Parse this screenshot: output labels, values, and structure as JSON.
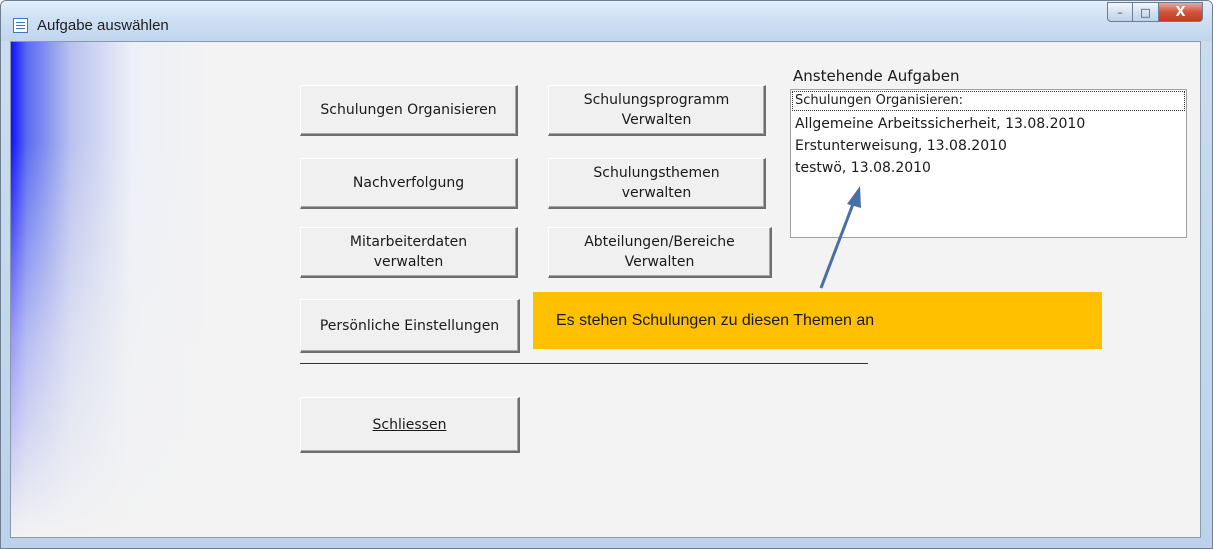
{
  "window": {
    "title": "Aufgabe auswählen",
    "controls": {
      "minimize": "–",
      "maximize": "□",
      "close": "X"
    }
  },
  "buttons": {
    "schulungen_organisieren": "Schulungen Organisieren",
    "schulungsprogramm_verwalten": [
      "Schulungsprogramm",
      "Verwalten"
    ],
    "nachverfolgung": "Nachverfolgung",
    "schulungsthemen_verwalten": [
      "Schulungsthemen",
      "verwalten"
    ],
    "mitarbeiterdaten_verwalten": [
      "Mitarbeiterdaten",
      "verwalten"
    ],
    "abteilungen_verwalten": [
      "Abteilungen/Bereiche",
      "Verwalten"
    ],
    "persoenliche_einstellungen": "Persönliche Einstellungen",
    "schliessen": "Schliessen"
  },
  "tasks": {
    "title": "Anstehende Aufgaben",
    "header": "Schulungen Organisieren:",
    "items": [
      "Allgemeine Arbeitssicherheit, 13.08.2010",
      "Erstunterweisung, 13.08.2010",
      "testwö, 13.08.2010"
    ]
  },
  "callout": {
    "text": "Es stehen Schulungen zu diesen Themen an",
    "color": "#ffc000",
    "arrow_color": "#4a6fa5"
  }
}
